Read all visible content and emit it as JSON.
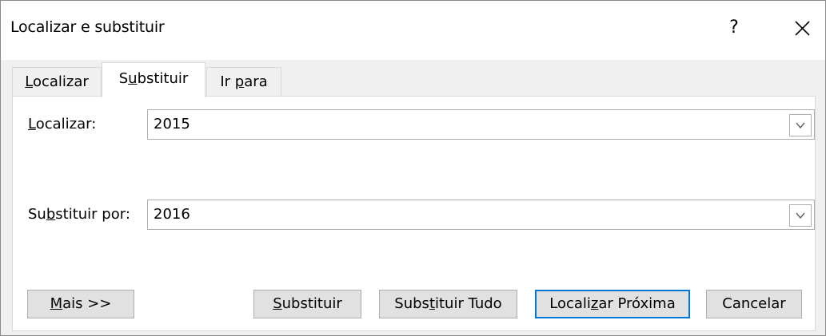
{
  "window": {
    "title": "Localizar e substituir",
    "help_label": "?"
  },
  "tabs": [
    {
      "pre": "",
      "ul": "L",
      "post": "ocalizar"
    },
    {
      "pre": "S",
      "ul": "u",
      "post": "bstituir"
    },
    {
      "pre": "Ir ",
      "ul": "p",
      "post": "ara"
    }
  ],
  "active_tab": "Substituir",
  "find": {
    "label_ul": "L",
    "label_post": "ocalizar:",
    "value": "2015"
  },
  "replace": {
    "label_pre": "Su",
    "label_ul": "b",
    "label_post": "stituir por:",
    "value": "2016"
  },
  "buttons": {
    "more": {
      "ul": "M",
      "post": "ais >>"
    },
    "replace": {
      "ul": "S",
      "post": "ubstituir"
    },
    "replace_all": {
      "pre": "Subs",
      "ul": "t",
      "post": "ituir Tudo"
    },
    "find_next": {
      "pre": "Locali",
      "ul": "z",
      "post": "ar Próxima"
    },
    "cancel": "Cancelar"
  },
  "colors": {
    "dialog_bg": "#f0f0f0",
    "button_bg": "#e1e1e1",
    "default_button_border": "#0078d7"
  },
  "icons": [
    "help-icon",
    "close-icon",
    "dropdown-arrow-icon"
  ]
}
